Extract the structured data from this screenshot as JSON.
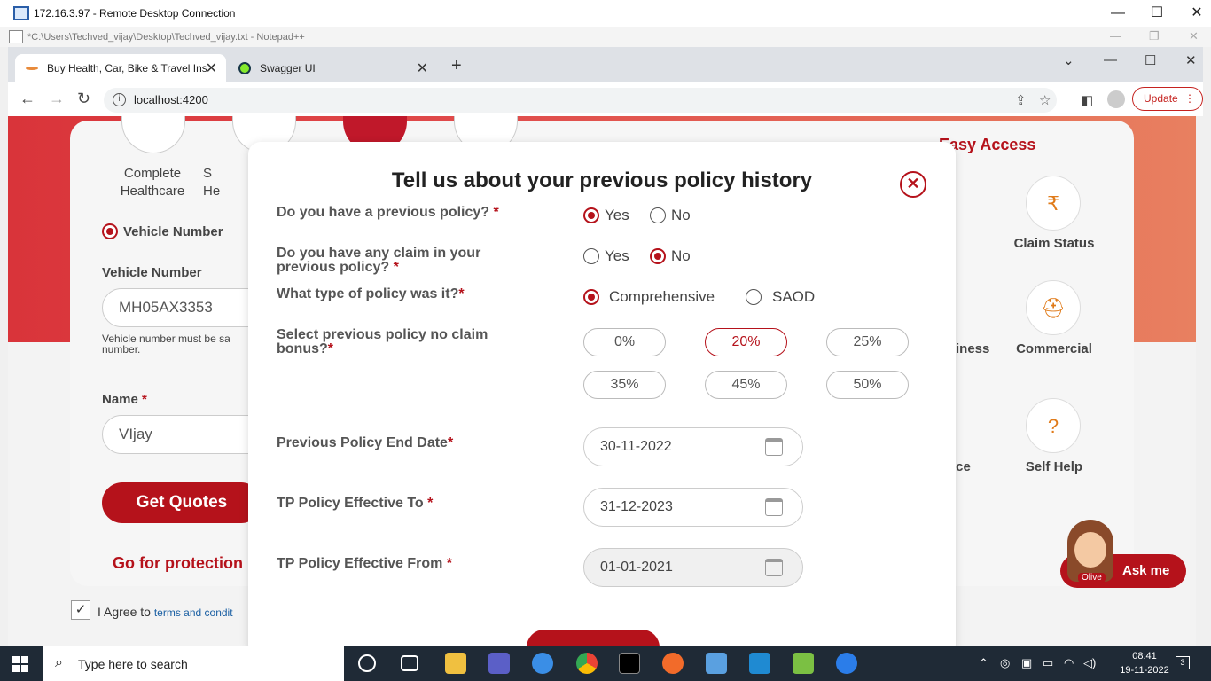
{
  "rdp": {
    "title": "172.16.3.97 - Remote Desktop Connection"
  },
  "notepad": {
    "title": "*C:\\Users\\Techved_vijay\\Desktop\\Techved_vijay.txt - Notepad++"
  },
  "browser": {
    "tabs": [
      {
        "label": "Buy Health, Car, Bike & Travel Ins"
      },
      {
        "label": "Swagger UI"
      }
    ],
    "url": "localhost:4200",
    "update_label": "Update"
  },
  "background": {
    "products": [
      {
        "label_line1": "Complete",
        "label_line2": "Healthcare"
      },
      {
        "label_line1": "S",
        "label_line2": "He"
      }
    ],
    "vehicle_radio_label": "Vehicle Number",
    "vehicle_field_label": "Vehicle Number",
    "vehicle_value": "MH05AX3353",
    "vehicle_hint_line1": "Vehicle number must be sa",
    "vehicle_hint_line2": "number.",
    "name_label": "Name",
    "name_value": "VIjay",
    "get_quotes": "Get Quotes",
    "promo": "Go for protection",
    "agree_text": "I Agree to",
    "agree_link": "terms and condit",
    "easy_access_title": "Easy Access",
    "easy_items": [
      {
        "label": "Claim Status",
        "icon": "money-bag-icon"
      },
      {
        "label": "Commercial",
        "icon": "worker-icon"
      },
      {
        "label": "Self Help",
        "icon": "question-hand-icon"
      }
    ],
    "easy_partial": [
      "iness",
      "nce"
    ],
    "ask_me": "Ask me",
    "olive": "Olive"
  },
  "modal": {
    "title": "Tell us about your previous policy history",
    "q1": {
      "label": "Do you have a previous policy?",
      "star": "*",
      "options": [
        "Yes",
        "No"
      ],
      "selected": "Yes"
    },
    "q2": {
      "label_line1": "Do you have any claim in your",
      "label_line2": "previous policy?",
      "star": "*",
      "options": [
        "Yes",
        "No"
      ],
      "selected": "No"
    },
    "q3": {
      "label": "What type of policy was it?",
      "star": "*",
      "options": [
        "Comprehensive",
        "SAOD"
      ],
      "selected": "Comprehensive"
    },
    "q4": {
      "label_line1": "Select previous policy no claim",
      "label_line2": "bonus?",
      "star": "*",
      "options": [
        "0%",
        "20%",
        "25%",
        "35%",
        "45%",
        "50%"
      ],
      "selected": "20%"
    },
    "prev_end": {
      "label": "Previous Policy End Date",
      "star": "*",
      "value": "30-11-2022"
    },
    "tp_to": {
      "label": "TP Policy Effective To",
      "star": "*",
      "value": "31-12-2023"
    },
    "tp_from": {
      "label": "TP Policy Effective From",
      "star": "*",
      "value": "01-01-2021"
    }
  },
  "taskbar": {
    "search_placeholder": "Type here to search",
    "time": "08:41",
    "date": "19-11-2022",
    "notifications": "3"
  },
  "colors": {
    "brand": "#b5121b",
    "taskbar": "#1f2a36"
  }
}
